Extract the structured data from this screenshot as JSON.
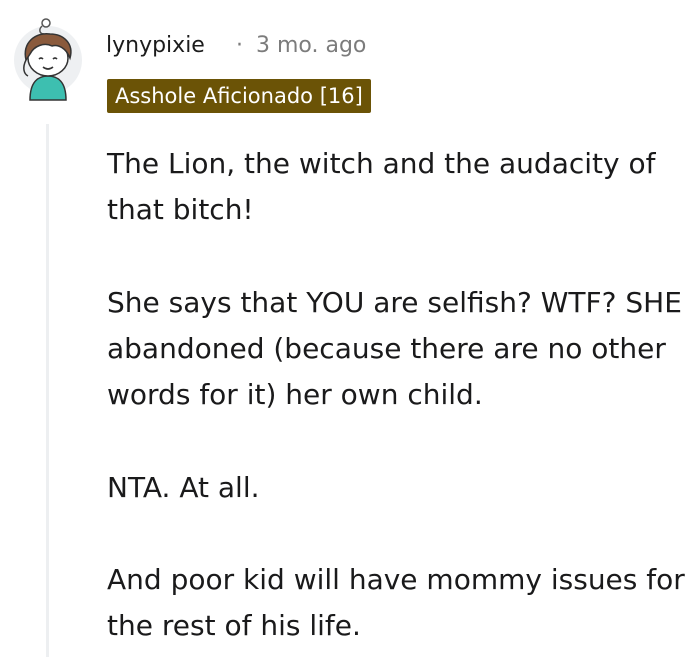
{
  "comment": {
    "author": "lynypixie",
    "separator": "·",
    "timestamp": "3 mo. ago",
    "flair": "Asshole Aficionado [16]",
    "paragraphs": [
      "The Lion, the witch and the audacity of that bitch!",
      "She says that YOU are selfish? WTF? SHE abandoned (because there are no other words for it) her own child.",
      "NTA. At all.",
      "And poor kid will have mommy issues for the rest of his life."
    ],
    "avatar_icon": "snoo-avatar-icon"
  },
  "colors": {
    "flair_background": "#6b5306",
    "flair_text": "#ffffff",
    "meta_text": "#7c7c7c",
    "thread_line": "#edeff1"
  }
}
